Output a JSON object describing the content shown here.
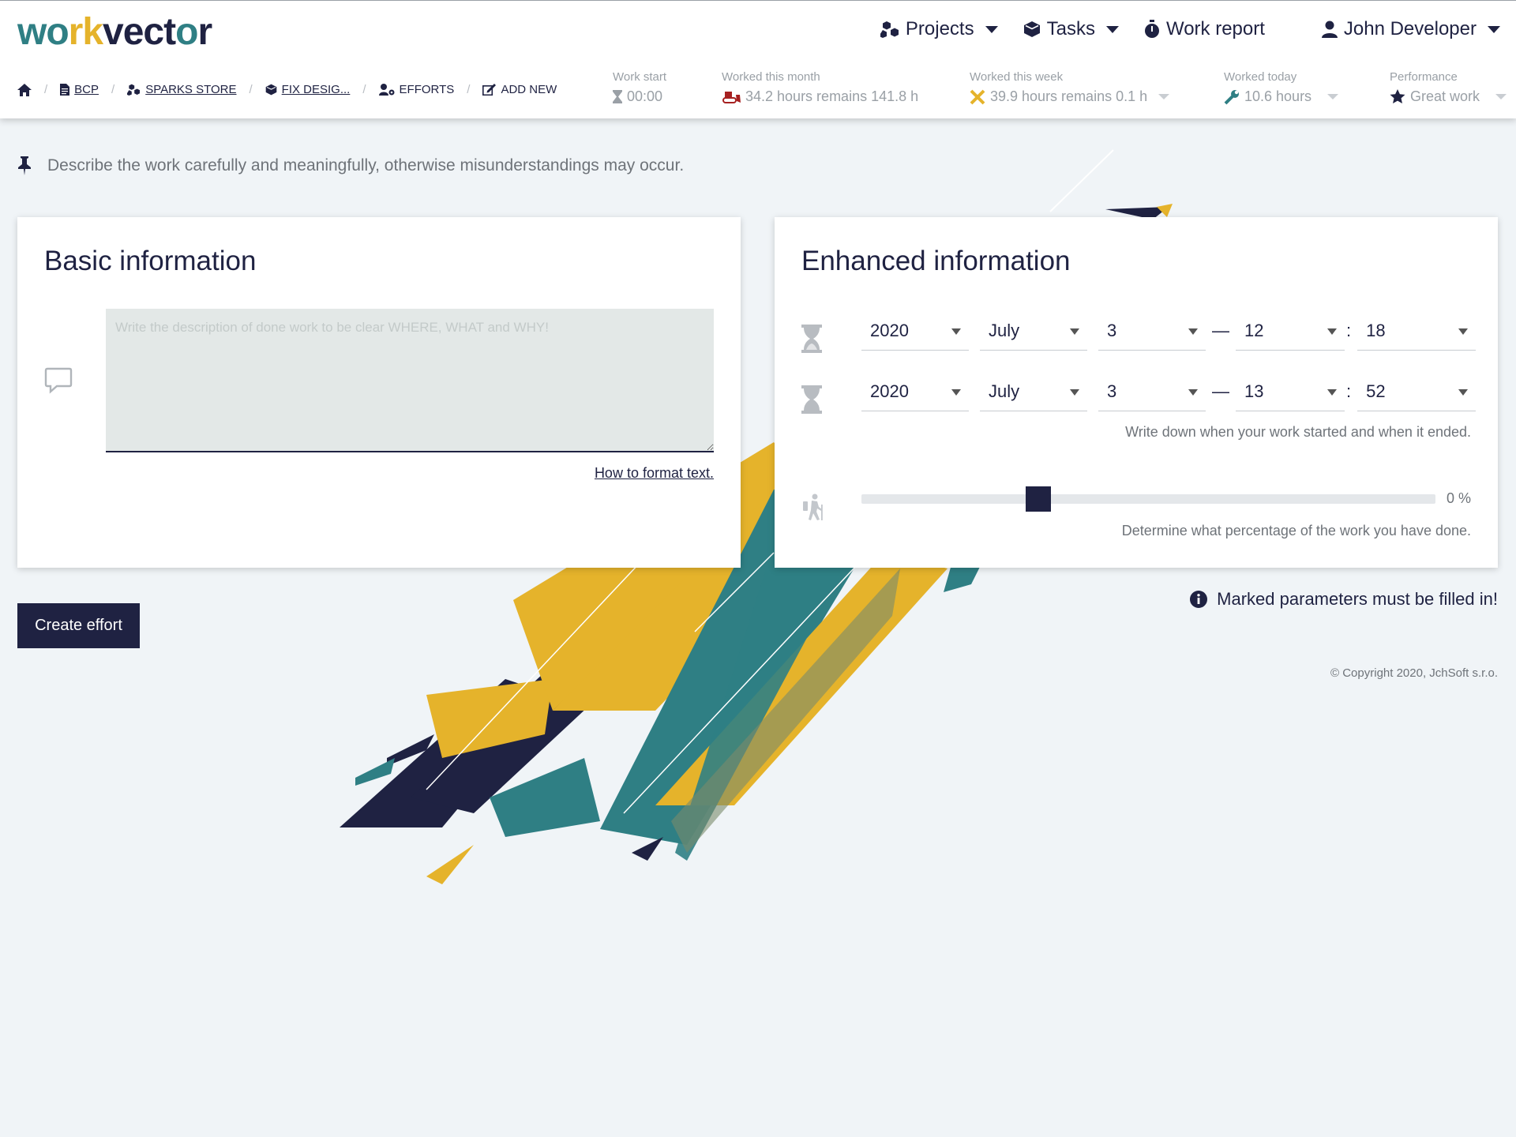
{
  "logo": {
    "part1": "wo",
    "part2": "rk",
    "part3": "vect",
    "part4": "o",
    "part5": "r"
  },
  "nav": {
    "projects": "Projects",
    "tasks": "Tasks",
    "work_report": "Work report",
    "user": "John Developer"
  },
  "breadcrumbs": {
    "bcp": "BCP",
    "sparks_store": "SPARKS STORE",
    "fix_design": "FIX DESIG...",
    "efforts": "EFFORTS",
    "add_new": "ADD NEW"
  },
  "stats": {
    "work_start": {
      "label": "Work start",
      "value": "00:00"
    },
    "month": {
      "label": "Worked this month",
      "value": "34.2 hours remains 141.8 h"
    },
    "week": {
      "label": "Worked this week",
      "value": "39.9 hours remains 0.1 h"
    },
    "today": {
      "label": "Worked today",
      "value": "10.6 hours"
    },
    "performance": {
      "label": "Performance",
      "value": "Great work"
    }
  },
  "notice": "Describe the work carefully and meaningfully, otherwise misunderstandings may occur.",
  "basic": {
    "title": "Basic information",
    "placeholder": "Write the description of done work to be clear WHERE, WHAT and WHY!",
    "format_link": "How to format text."
  },
  "enhanced": {
    "title": "Enhanced information",
    "start": {
      "year": "2020",
      "month": "July",
      "day": "3",
      "hour": "12",
      "minute": "18"
    },
    "end": {
      "year": "2020",
      "month": "July",
      "day": "3",
      "hour": "13",
      "minute": "52"
    },
    "dash": "—",
    "colon": ":",
    "time_hint": "Write down when your work started and when it ended.",
    "progress": 0,
    "progress_label": "0 %",
    "progress_hint": "Determine what percentage of the work you have done."
  },
  "create_button": "Create effort",
  "mandatory_note": "Marked parameters must be filled in!",
  "copyright": "© Copyright 2020, JchSoft s.r.o.",
  "colors": {
    "navy": "#1f2242",
    "teal": "#2f7f84",
    "yellow": "#e5b32b"
  }
}
